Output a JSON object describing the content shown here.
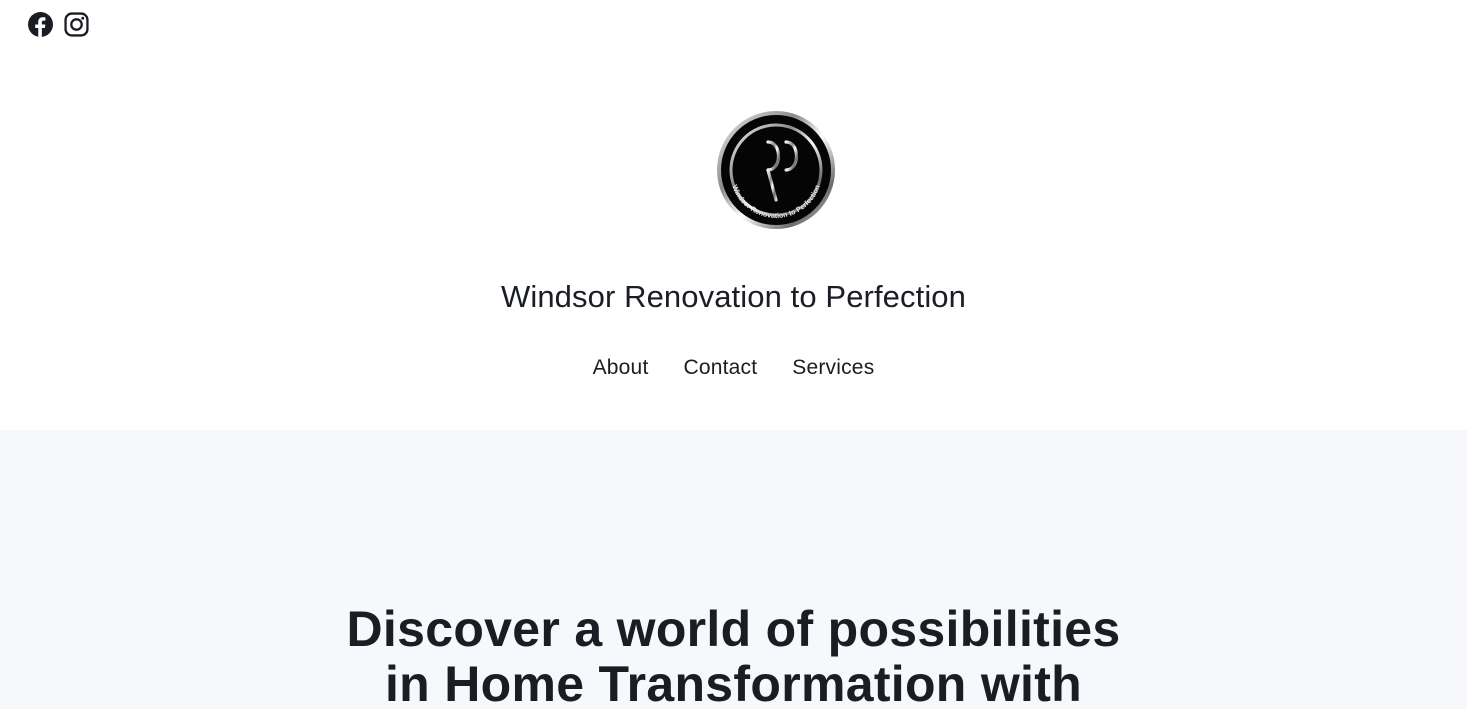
{
  "social": {
    "facebook_icon": "facebook-icon",
    "instagram_icon": "instagram-icon"
  },
  "logo": {
    "monogram": "RP",
    "ring_text": "Windsor Renovation to Perfection"
  },
  "site": {
    "title": "Windsor Renovation to Perfection"
  },
  "nav": {
    "items": [
      {
        "label": "About"
      },
      {
        "label": "Contact"
      },
      {
        "label": "Services"
      }
    ]
  },
  "hero": {
    "heading": "Discover a world of possibilities in Home Transformation with"
  },
  "colors": {
    "text": "#1a1d23",
    "hero_bg": "#f7f8fb",
    "header_bg": "#ffffff"
  }
}
